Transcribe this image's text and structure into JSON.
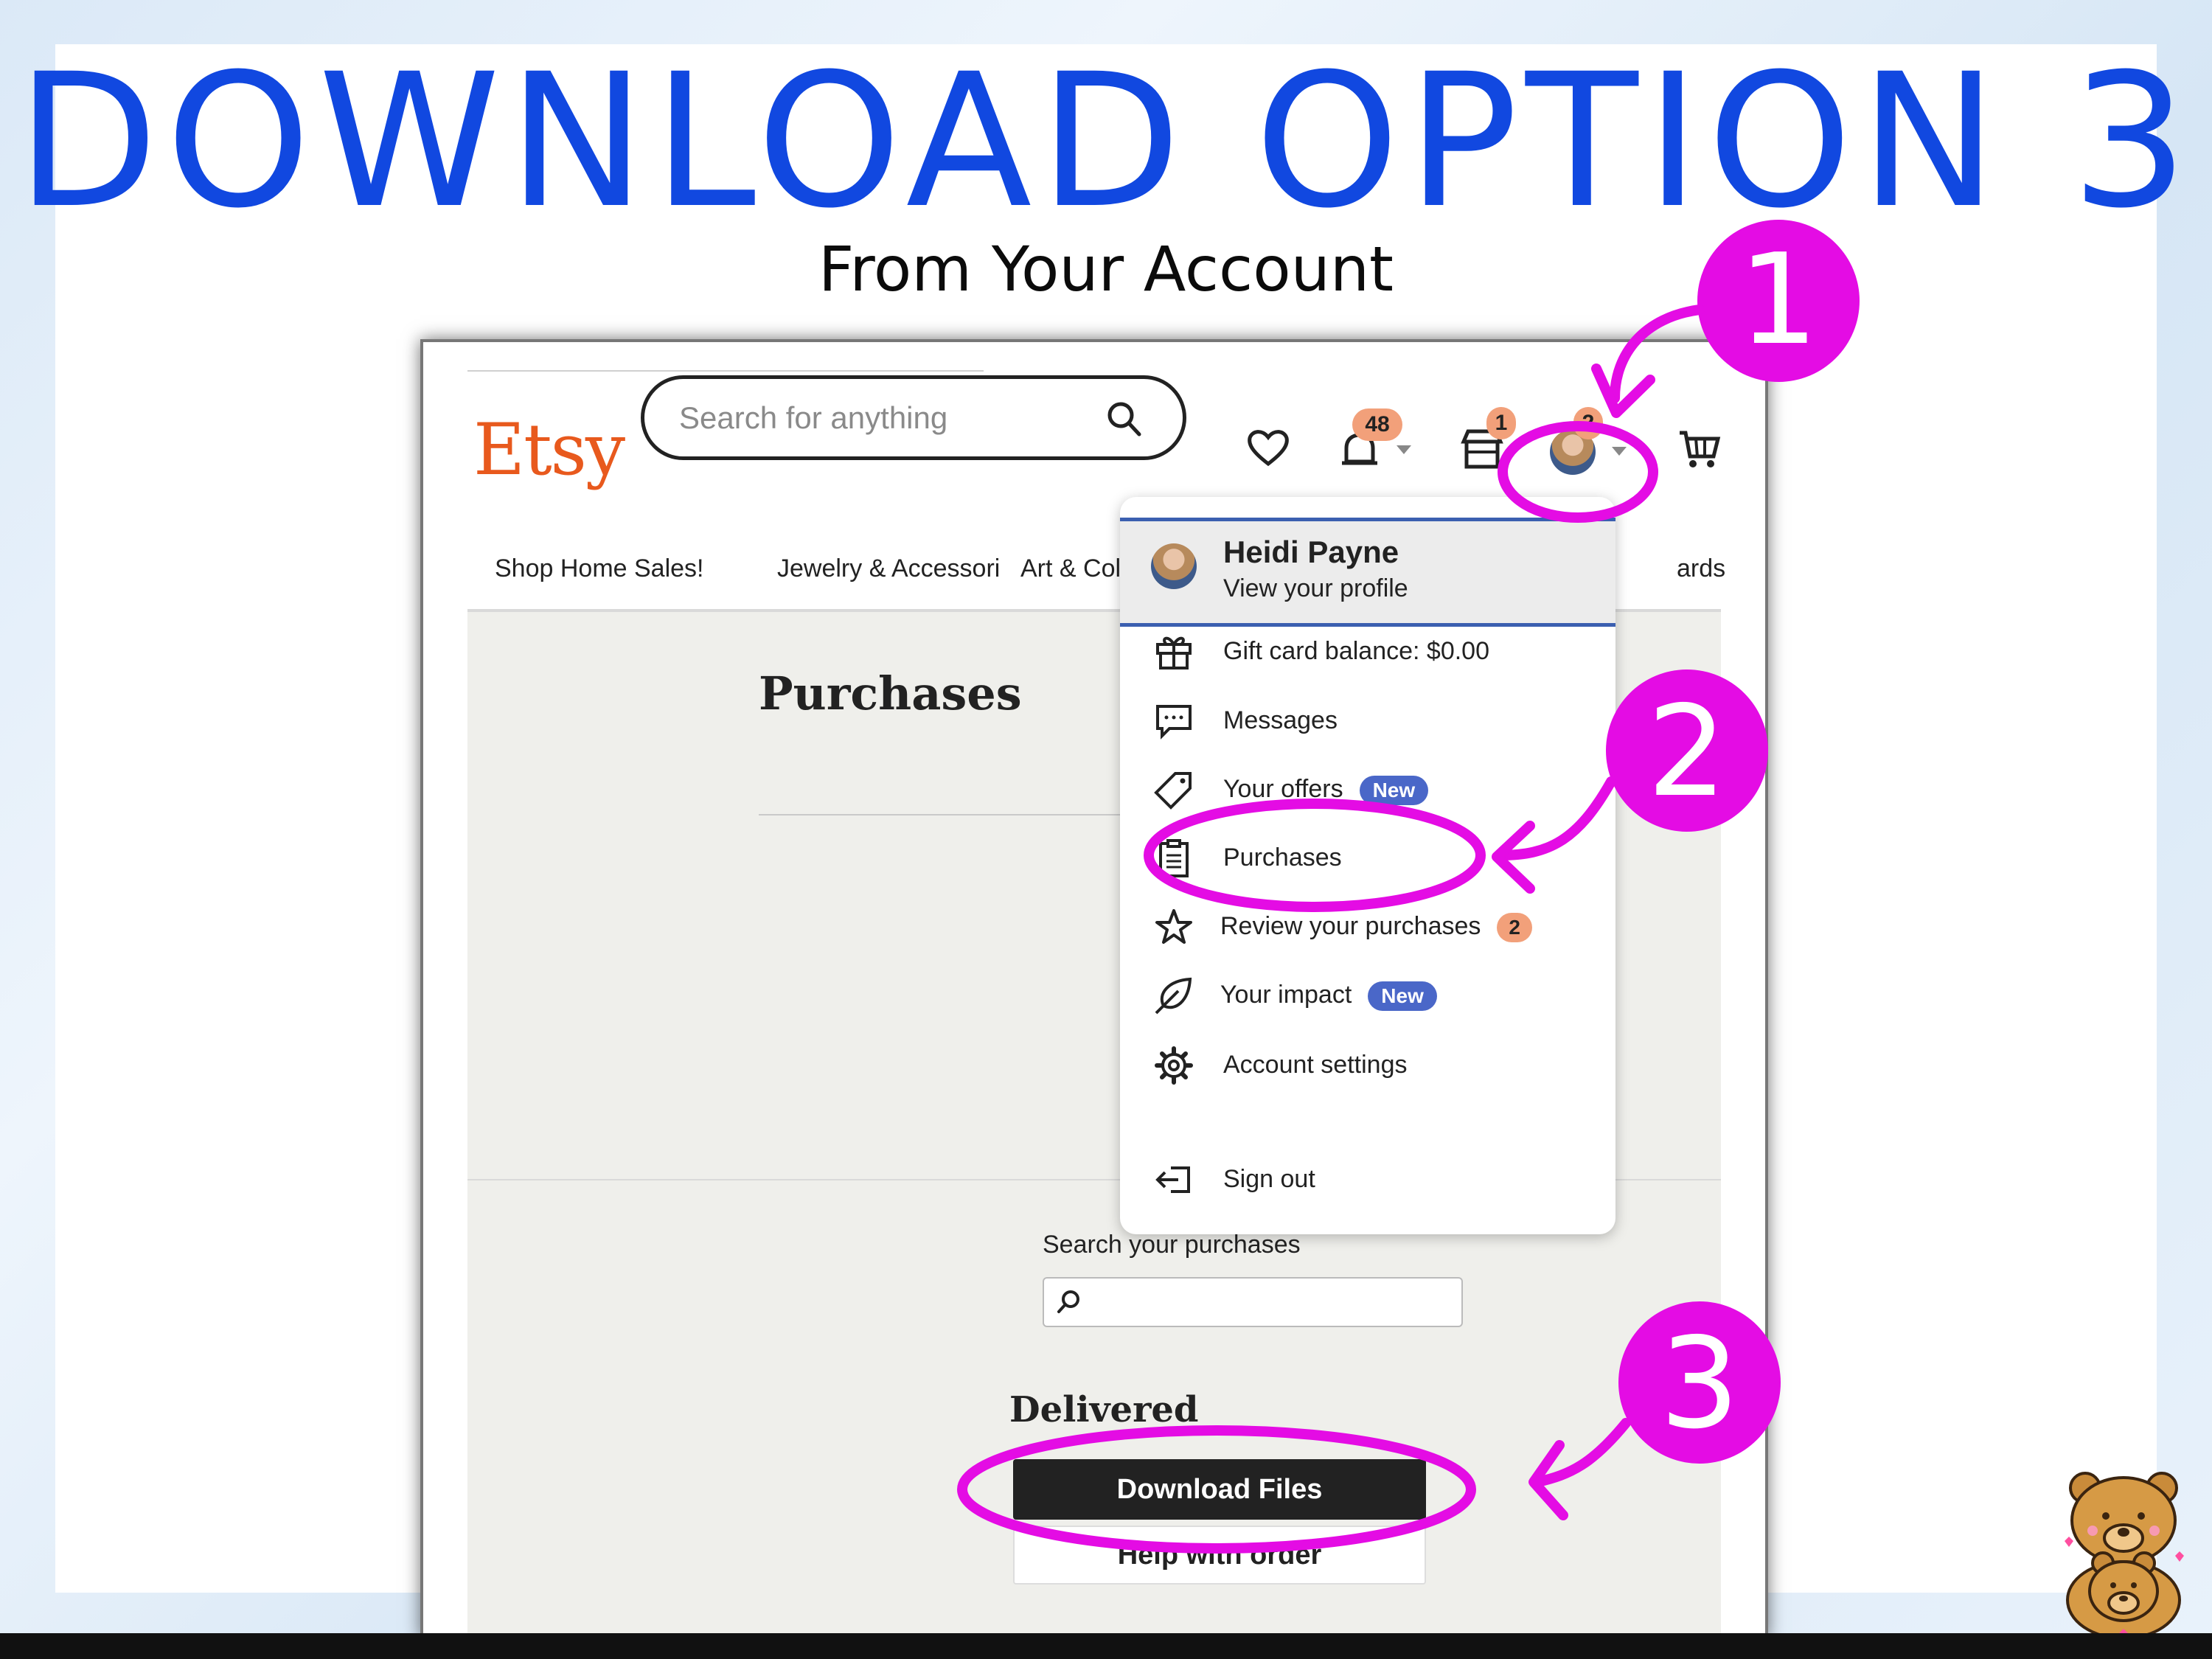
{
  "headline": "DOWNLOAD OPTION 3",
  "subheadline": "From Your Account",
  "etsy": {
    "logo": "Etsy",
    "search_placeholder": "Search for anything",
    "badges": {
      "notifications": "48",
      "shop": "1",
      "account": "2"
    },
    "nav": [
      "Shop Home Sales!",
      "Jewelry & Accessori",
      "Art & Collect",
      "ards"
    ],
    "page_title": "Purchases",
    "search_purchases_label": "Search your purchases",
    "section_delivered": "Delivered",
    "download_button": "Download Files",
    "help_button": "Help with order"
  },
  "menu": {
    "profile_name": "Heidi Payne",
    "profile_sub": "View your profile",
    "items": [
      {
        "label": "Gift card balance: $0.00",
        "icon": "gift-icon"
      },
      {
        "label": "Messages",
        "icon": "message-icon"
      },
      {
        "label": "Your offers",
        "icon": "tag-icon",
        "pill": "New"
      },
      {
        "label": "Purchases",
        "icon": "clipboard-icon"
      },
      {
        "label": "Review your purchases",
        "icon": "star-icon",
        "count": "2"
      },
      {
        "label": "Your impact",
        "icon": "leaf-icon",
        "pill": "New"
      },
      {
        "label": "Account settings",
        "icon": "gear-icon"
      },
      {
        "label": "Sign out",
        "icon": "sign-out-icon"
      }
    ]
  },
  "steps": [
    "1",
    "2",
    "3"
  ],
  "colors": {
    "headline": "#1148e0",
    "annotation": "#e40ce4",
    "etsy_orange": "#e8591d",
    "new_pill": "#4a67c8",
    "badge": "#f2a07a"
  }
}
